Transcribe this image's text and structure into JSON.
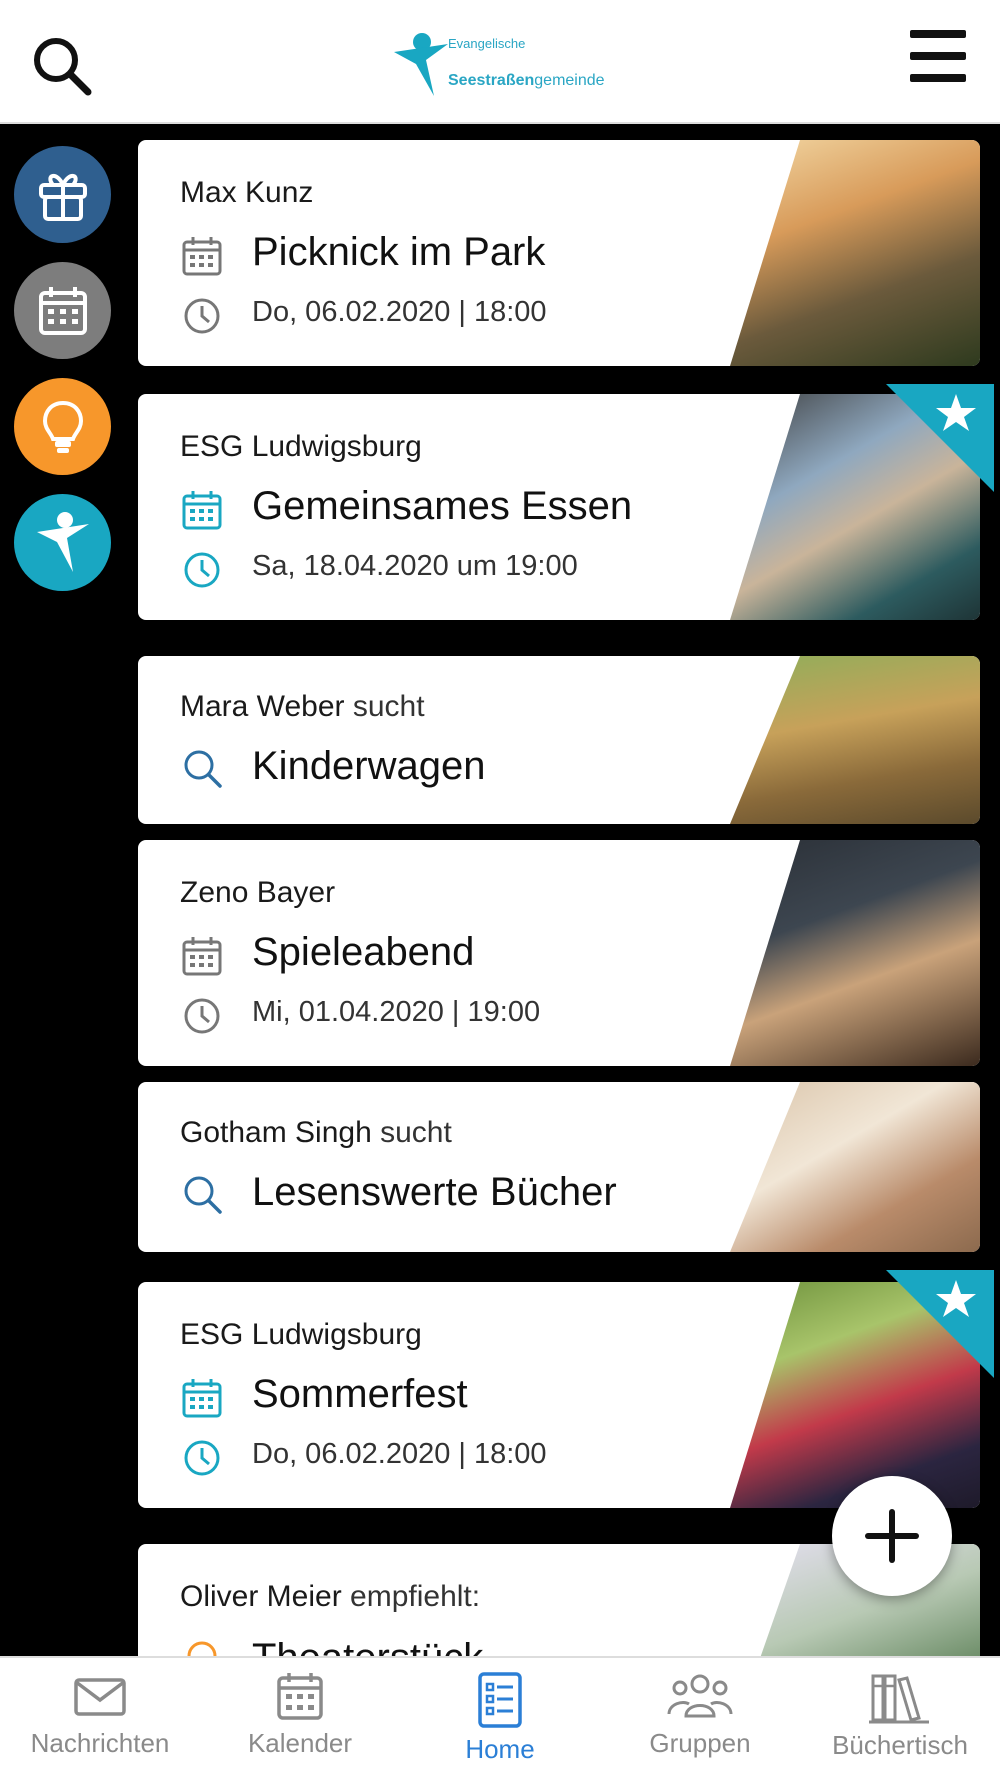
{
  "header": {
    "logo_line1": "Evangelische",
    "logo_bold": "Seestraßen",
    "logo_rest": "gemeinde"
  },
  "colors": {
    "accent_teal": "#19a7c2",
    "rail_blue": "#2f5f8f",
    "rail_gray": "#7d7d7d",
    "rail_orange": "#f7972b",
    "nav_active": "#2b7fd6"
  },
  "rail": [
    {
      "icon": "gift-icon"
    },
    {
      "icon": "calendar-icon"
    },
    {
      "icon": "lightbulb-icon"
    },
    {
      "icon": "church-logo-icon"
    }
  ],
  "cards": [
    {
      "author": "Max Kunz",
      "suffix": "",
      "title": "Picknick im Park",
      "datetime": "Do, 06.02.2020 | 18:00",
      "type": "event",
      "featured": false
    },
    {
      "author": "ESG Ludwigsburg",
      "suffix": "",
      "title": "Gemeinsames Essen",
      "datetime": "Sa, 18.04.2020 um 19:00",
      "type": "event",
      "featured": true
    },
    {
      "author": "Mara Weber",
      "suffix": " sucht",
      "title": "Kinderwagen",
      "type": "search"
    },
    {
      "author": "Zeno Bayer",
      "suffix": "",
      "title": "Spieleabend",
      "datetime": "Mi, 01.04.2020 | 19:00",
      "type": "event",
      "featured": false
    },
    {
      "author": "Gotham Singh",
      "suffix": " sucht",
      "title": "Lesenswerte Bücher",
      "type": "search"
    },
    {
      "author": "ESG Ludwigsburg",
      "suffix": "",
      "title": "Sommerfest",
      "datetime": "Do, 06.02.2020 | 18:00",
      "type": "event",
      "featured": true
    },
    {
      "author": "Oliver Meier",
      "suffix": " empfiehlt:",
      "title": "Theaterstück",
      "type": "recommend"
    }
  ],
  "bottom_nav": [
    {
      "label": "Nachrichten",
      "icon": "mail-icon",
      "active": false
    },
    {
      "label": "Kalender",
      "icon": "calendar-icon",
      "active": false
    },
    {
      "label": "Home",
      "icon": "home-list-icon",
      "active": true
    },
    {
      "label": "Gruppen",
      "icon": "group-icon",
      "active": false
    },
    {
      "label": "Büchertisch",
      "icon": "books-icon",
      "active": false
    }
  ]
}
